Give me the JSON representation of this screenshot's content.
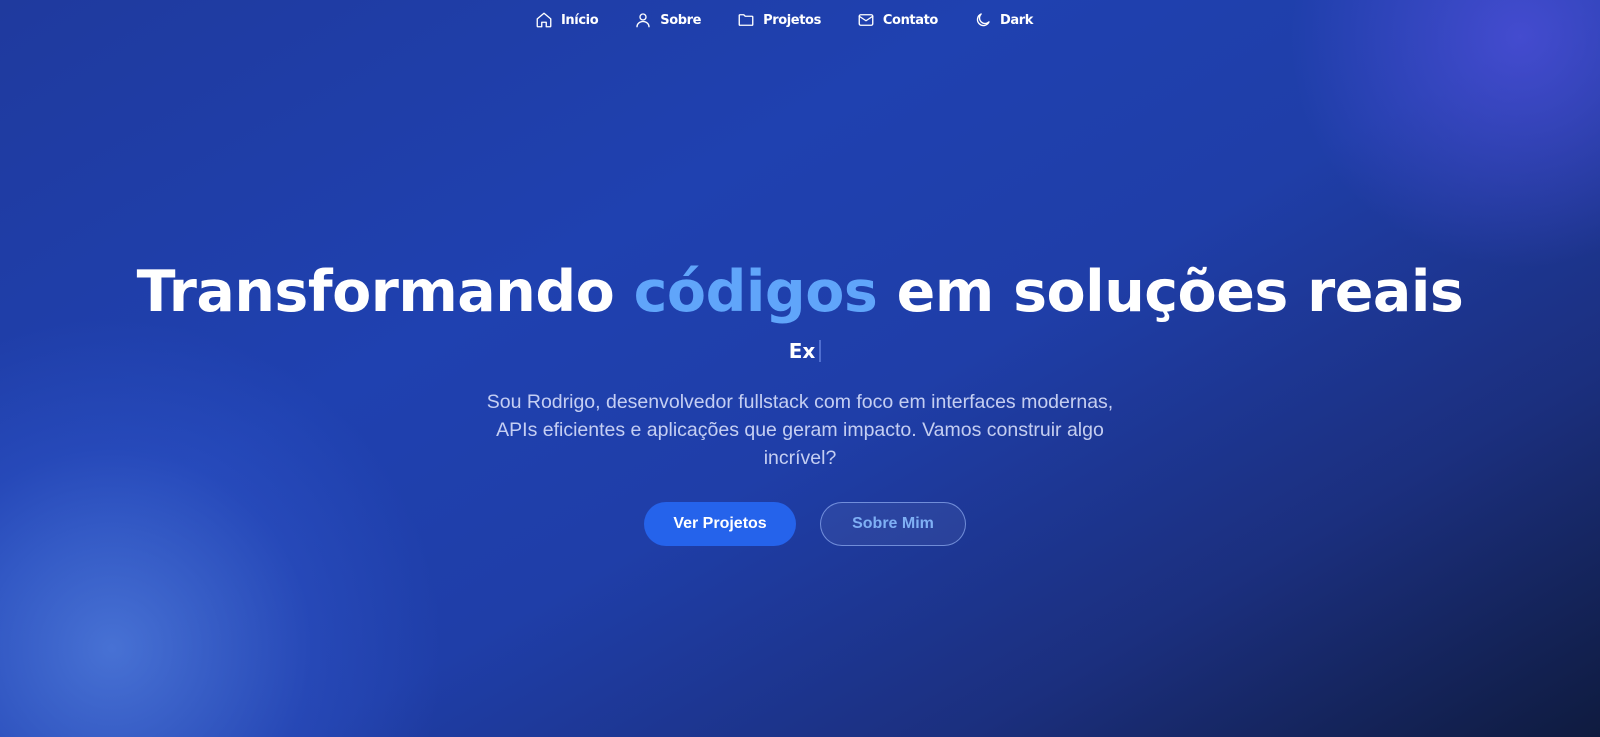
{
  "nav": {
    "items": [
      {
        "label": "Início",
        "icon": "home-icon"
      },
      {
        "label": "Sobre",
        "icon": "user-icon"
      },
      {
        "label": "Projetos",
        "icon": "folder-icon"
      },
      {
        "label": "Contato",
        "icon": "mail-icon"
      },
      {
        "label": "Dark",
        "icon": "moon-icon"
      }
    ]
  },
  "hero": {
    "title_part1": "Transformando ",
    "title_accent": "códigos",
    "title_part2": " em soluções reais",
    "typing_text": "Ex",
    "description": "Sou Rodrigo, desenvolvedor fullstack com foco em interfaces modernas, APIs eficientes e aplicações que geram impacto. Vamos construir algo incrível?",
    "primary_button": "Ver Projetos",
    "secondary_button": "Sobre Mim"
  },
  "colors": {
    "accent": "#60a5fa",
    "primary_button": "#2563eb",
    "secondary_text": "#7fb0f5"
  }
}
